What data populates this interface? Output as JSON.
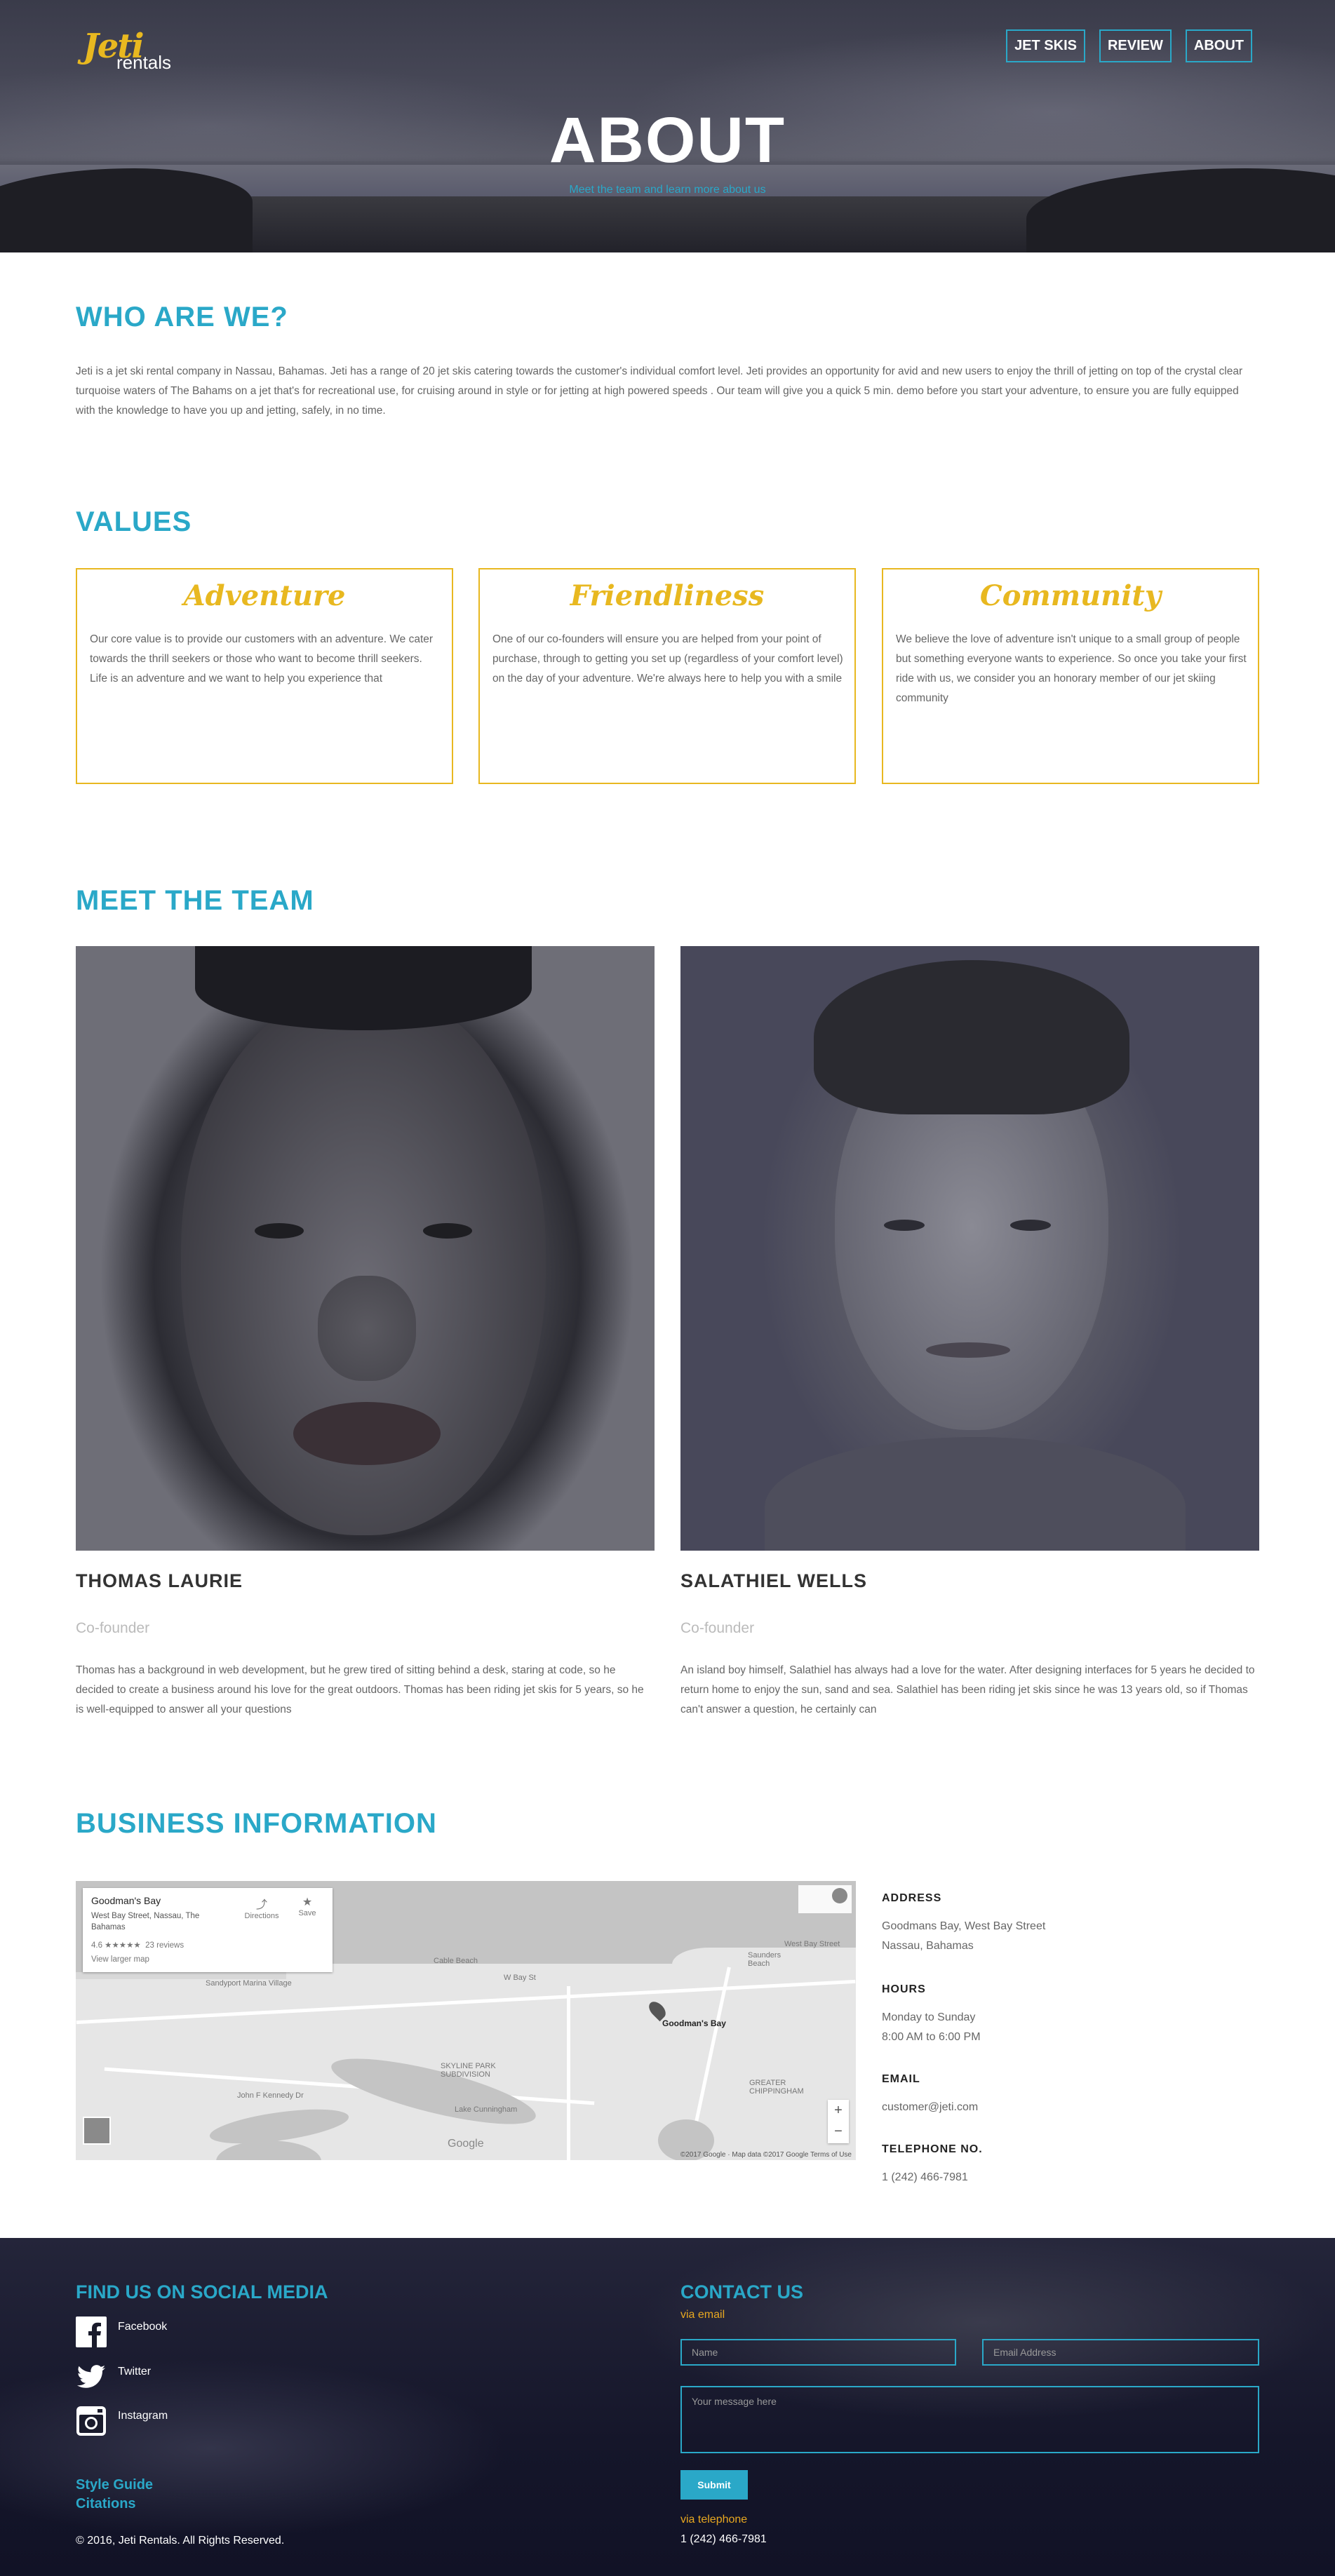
{
  "brand": {
    "logo_mark": "Jeti",
    "logo_word": "rentals",
    "accent": "#2aa8c8",
    "yellow": "#e8b820"
  },
  "nav": {
    "items": [
      "JET SKIS",
      "REVIEW",
      "ABOUT"
    ]
  },
  "hero": {
    "title": "ABOUT",
    "subtitle": "Meet the team and learn more about us"
  },
  "who": {
    "heading": "WHO ARE WE?",
    "text": "Jeti is a jet ski rental company in Nassau, Bahamas. Jeti has a range of 20 jet skis catering towards the customer's individual comfort level. Jeti provides an opportunity for avid and new users to enjoy the thrill of jetting on top of the crystal clear turquoise waters of The Bahams on a jet that's for recreational use, for cruising around in style or for jetting at high powered speeds . Our team will give you a quick 5 min. demo before you start your adventure, to ensure you are fully equipped with the knowledge to have you up and jetting, safely, in no time."
  },
  "values": {
    "heading": "VALUES",
    "cards": [
      {
        "title": "Adventure",
        "text": "Our core value is to provide our customers with an adventure. We cater towards the thrill seekers or those who want to become thrill seekers. Life is an adventure and we want to help you experience that"
      },
      {
        "title": "Friendliness",
        "text": "One of our co-founders will ensure you are helped from your point of purchase, through to getting you set up (regardless of your comfort level) on the day of your adventure. We're always here to help you with a smile"
      },
      {
        "title": "Community",
        "text": "We believe the love of adventure isn't unique to a small group of people but something everyone wants to experience. So once you take your first ride with us, we consider you an honorary member of our jet skiing community"
      }
    ]
  },
  "team": {
    "heading": "MEET THE TEAM",
    "members": [
      {
        "name": "THOMAS LAURIE",
        "role": "Co-founder",
        "bio": "Thomas has a background in web development, but he grew tired of sitting behind a desk, staring at code, so he decided to create a business around his love for the great outdoors. Thomas has been riding jet skis for 5 years, so he is well-equipped to answer all your questions"
      },
      {
        "name": "SALATHIEL WELLS",
        "role": "Co-founder",
        "bio": "An island boy himself, Salathiel has always had a love for the water. After designing interfaces for 5 years he decided to return home to enjoy the sun, sand and sea. Salathiel has been riding jet skis since he was 13 years old, so if Thomas can't answer a question, he certainly can"
      }
    ]
  },
  "business": {
    "heading": "BUSINESS INFORMATION",
    "map": {
      "place": "Goodman's Bay",
      "address": "West Bay Street, Nassau, The Bahamas",
      "rating": "4.6 ★★★★★",
      "reviews": "23 reviews",
      "larger": "View larger map",
      "directions": "Directions",
      "save": "Save",
      "pin_label": "Goodman's Bay",
      "credit": "©2017 Google · Map data ©2017 Google   Terms of Use",
      "google": "Google",
      "labels": [
        "Sandyport Marina Village",
        "Cable Beach",
        "W Bay St",
        "SKYLINE PARK SUBDIVISION",
        "GREATER CHIPPINGHAM",
        "John F Kennedy Dr",
        "Lake Cunningham",
        "Saunders Beach",
        "West Bay Street"
      ],
      "zoom_in": "+",
      "zoom_out": "−"
    },
    "address_label": "ADDRESS",
    "address": [
      "Goodmans Bay, West Bay Street",
      "Nassau, Bahamas"
    ],
    "hours_label": "HOURS",
    "hours": [
      "Monday to Sunday",
      "8:00 AM to 6:00 PM"
    ],
    "email_label": "EMAIL",
    "email": "customer@jeti.com",
    "phone_label": "TELEPHONE NO.",
    "phone": "1 (242) 466-7981"
  },
  "footer": {
    "social_heading": "FIND US ON SOCIAL MEDIA",
    "social": [
      {
        "label": "Facebook",
        "icon": "facebook-icon"
      },
      {
        "label": "Twitter",
        "icon": "twitter-icon"
      },
      {
        "label": "Instagram",
        "icon": "instagram-icon"
      }
    ],
    "style_guide": "Style Guide",
    "citations": "Citations",
    "copyright": "© 2016, Jeti Rentals. All Rights Reserved.",
    "contact_heading": "CONTACT US",
    "via_email": "via email",
    "name_placeholder": "Name",
    "email_placeholder": "Email Address",
    "message_placeholder": "Your message here",
    "submit": "Submit",
    "via_telephone": "via telephone",
    "telephone": "1 (242) 466-7981"
  }
}
